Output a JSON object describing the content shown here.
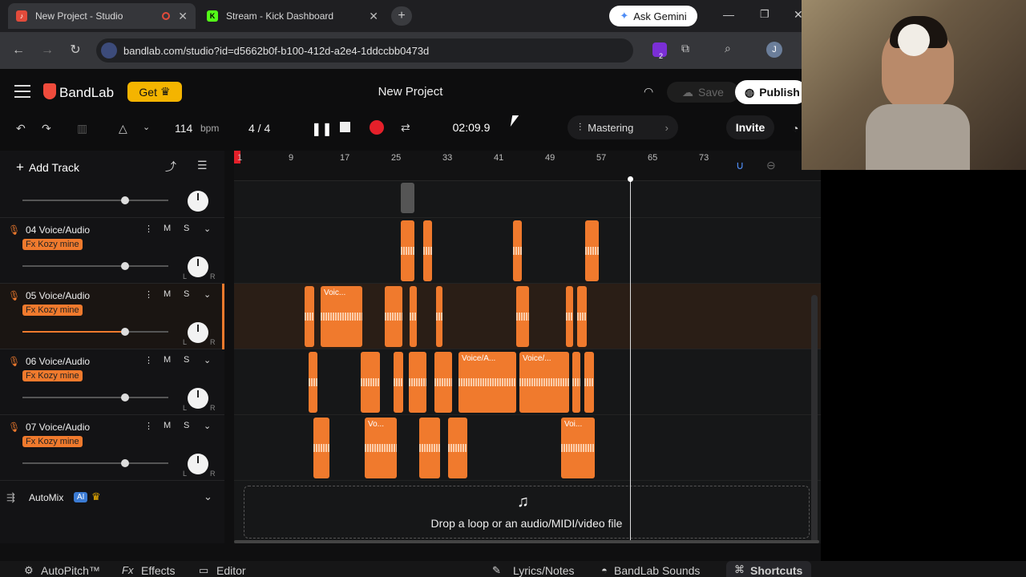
{
  "tabs": [
    {
      "title": "New Project - Studio",
      "active": true
    },
    {
      "title": "Stream - Kick Dashboard",
      "active": false
    }
  ],
  "gemini_label": "Ask Gemini",
  "url": "bandlab.com/studio?id=d5662b0f-b100-412d-a2e4-1ddccbb0473d",
  "extension_badge": "2",
  "profile_initial": "J",
  "app": {
    "brand": "BandLab",
    "get_label": "Get",
    "project_title": "New Project",
    "save_label": "Save",
    "publish_label": "Publish"
  },
  "transport": {
    "tempo": "114",
    "tempo_unit": "bpm",
    "time_signature": "4 / 4",
    "time": "02:09.9",
    "mastering_label": "Mastering",
    "invite_label": "Invite"
  },
  "add_track_label": "Add Track",
  "ruler_ticks": [
    "1",
    "9",
    "17",
    "25",
    "33",
    "41",
    "49",
    "57",
    "65",
    "73"
  ],
  "tracks": [
    {
      "name": "04  Voice/Audio",
      "fx": "Fx Kozy mine",
      "volume": 0.7,
      "selected": false
    },
    {
      "name": "05  Voice/Audio",
      "fx": "Fx Kozy mine",
      "volume": 0.7,
      "selected": true
    },
    {
      "name": "06  Voice/Audio",
      "fx": "Fx Kozy mine",
      "volume": 0.7,
      "selected": false
    },
    {
      "name": "07  Voice/Audio",
      "fx": "Fx Kozy mine",
      "volume": 0.7,
      "selected": false
    }
  ],
  "mute_label": "M",
  "solo_label": "S",
  "pan_left": "L",
  "pan_right": "R",
  "automix_label": "AutoMix",
  "ai_badge": "AI",
  "clip_labels": {
    "t5": "Voic...",
    "t6a": "Voice/A...",
    "t6b": "Voice/...",
    "t7a": "Vo...",
    "t7b": "Voi..."
  },
  "drop_text": "Drop a loop or an audio/MIDI/video file",
  "bottom": {
    "autopitch": "AutoPitch™",
    "effects": "Effects",
    "editor": "Editor",
    "lyrics": "Lyrics/Notes",
    "sounds": "BandLab Sounds",
    "shortcuts": "Shortcuts"
  },
  "colors": {
    "accent": "#f07a2d",
    "record": "#e5202a",
    "get_button": "#f4b400"
  }
}
